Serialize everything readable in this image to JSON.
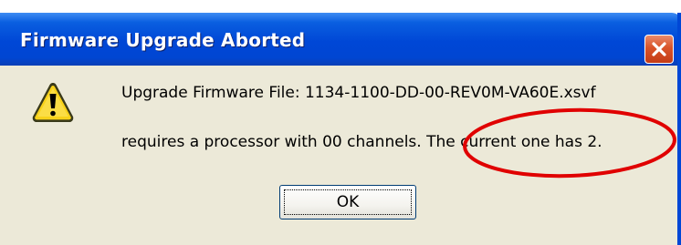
{
  "window": {
    "title": "Firmware Upgrade Aborted",
    "close_icon": "close-icon"
  },
  "message": {
    "icon": "warning-icon",
    "line1": "Upgrade Firmware File:  1134-1100-DD-00-REV0M-VA60E.xsvf",
    "line2": "requires a processor with 00 channels. The current one has 2."
  },
  "buttons": {
    "ok_label": "OK"
  },
  "annotation": {
    "shape": "ellipse",
    "color": "#e00000"
  },
  "colors": {
    "titlebar": "#0047d6",
    "client_background": "#ece9d8",
    "close_button": "#d9542a",
    "warning_yellow": "#f8d21a"
  }
}
